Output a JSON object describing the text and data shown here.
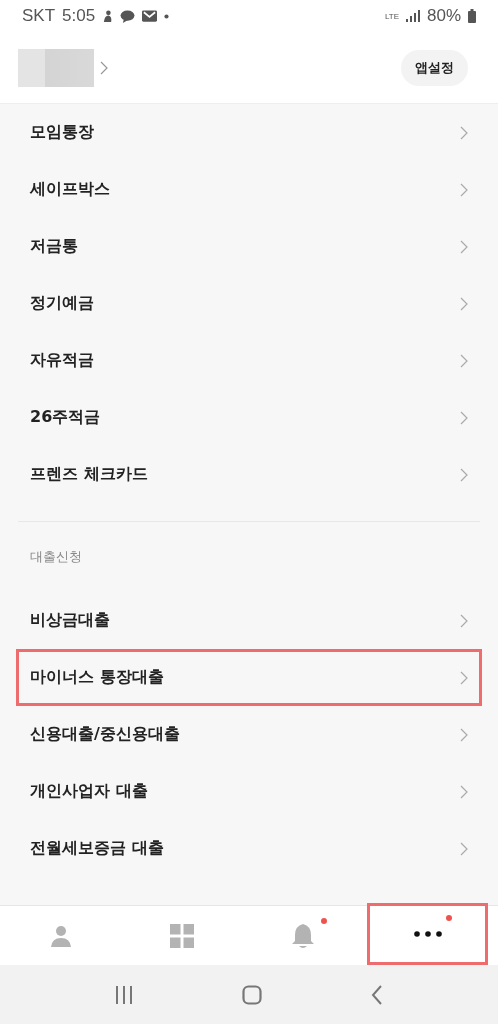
{
  "status_bar": {
    "carrier": "SKT",
    "time": "5:05",
    "network": "LTE",
    "battery": "80%"
  },
  "header": {
    "settings_button": "앱설정"
  },
  "products": [
    {
      "label": "모임통장",
      "highlighted": false
    },
    {
      "label": "세이프박스",
      "highlighted": false
    },
    {
      "label": "저금통",
      "highlighted": false
    },
    {
      "label": "정기예금",
      "highlighted": false
    },
    {
      "label": "자유적금",
      "highlighted": false
    },
    {
      "label": "26주적금",
      "highlighted": false
    },
    {
      "label": "프렌즈 체크카드",
      "highlighted": false
    }
  ],
  "loans": {
    "title": "대출신청",
    "items": [
      {
        "label": "비상금대출",
        "highlighted": false
      },
      {
        "label": "마이너스 통장대출",
        "highlighted": true
      },
      {
        "label": "신용대출/중신용대출",
        "highlighted": false
      },
      {
        "label": "개인사업자 대출",
        "highlighted": false
      },
      {
        "label": "전월세보증금 대출",
        "highlighted": false
      }
    ]
  },
  "bottom_nav": [
    {
      "kind": "profile",
      "selected": false,
      "badge": false,
      "highlighted": false
    },
    {
      "kind": "grid",
      "selected": false,
      "badge": false,
      "highlighted": false
    },
    {
      "kind": "bell",
      "selected": false,
      "badge": true,
      "highlighted": false
    },
    {
      "kind": "more",
      "selected": true,
      "badge": true,
      "highlighted": true
    }
  ]
}
